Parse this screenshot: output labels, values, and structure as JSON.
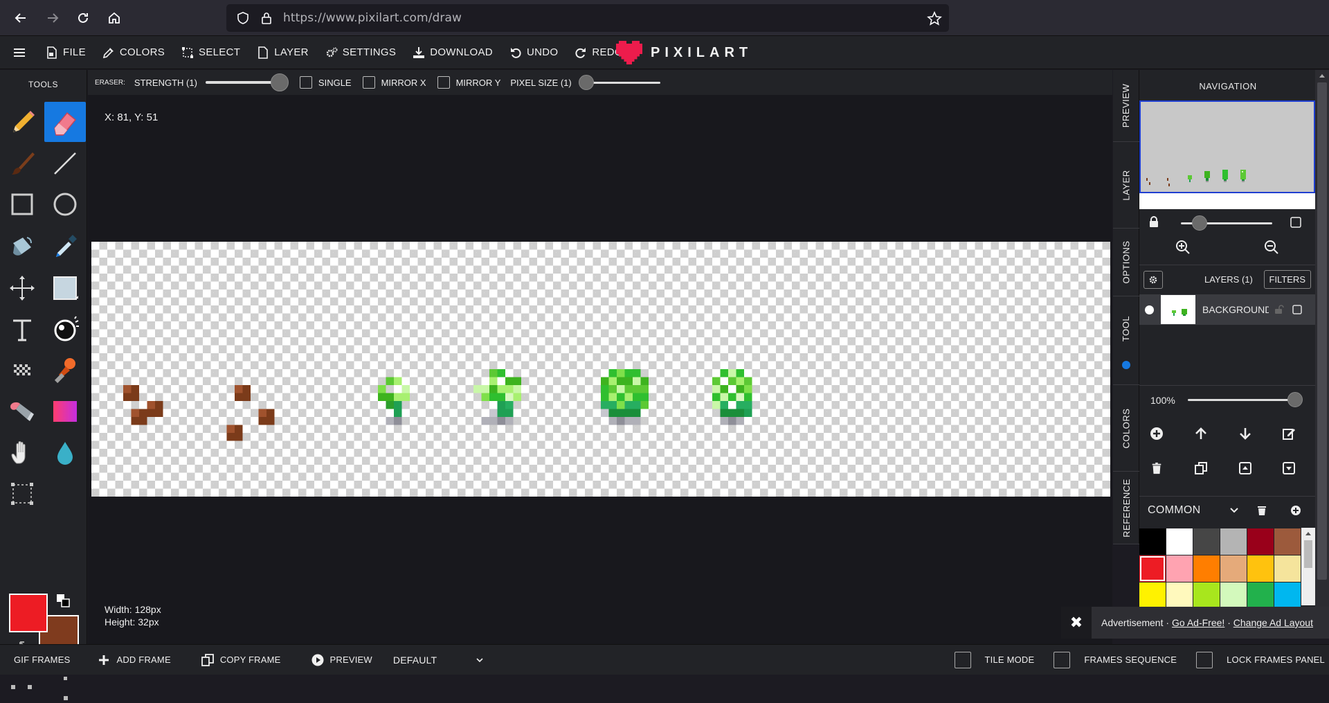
{
  "browser": {
    "url": "https://www.pixilart.com/draw"
  },
  "menu": {
    "file": "FILE",
    "colors": "COLORS",
    "select": "SELECT",
    "layer": "LAYER",
    "settings": "SETTINGS",
    "download": "DOWNLOAD",
    "undo": "UNDO",
    "redo": "REDO",
    "logo_text": "PIXILART"
  },
  "tools": {
    "title": "TOOLS",
    "active_tool": "eraser",
    "primary_color": "#ed1c24",
    "secondary_color": "#7f3b1e"
  },
  "options": {
    "tool_label": "ERASER:",
    "strength_label": "STRENGTH (1)",
    "strength_value": 1,
    "single_label": "SINGLE",
    "mirror_x_label": "MIRROR X",
    "mirror_y_label": "MIRROR Y",
    "pixel_size_label": "PIXEL SIZE (1)",
    "pixel_size_value": 1
  },
  "workspace": {
    "coords": "X: 81, Y: 51",
    "width_text": "Width: 128px",
    "height_text": "Height: 32px"
  },
  "side_tabs": {
    "preview": "PREVIEW",
    "layer": "LAYER",
    "options": "OPTIONS",
    "tool": "TOOL",
    "colors": "COLORS",
    "reference": "REFERENCE"
  },
  "panel": {
    "navigation_title": "NAVIGATION",
    "layers_title": "LAYERS (1)",
    "filters_label": "FILTERS",
    "layer_name": "BACKGROUND",
    "opacity_text": "100%",
    "opacity_value": 1.0,
    "palette_name": "COMMON",
    "swatches": [
      "#000000",
      "#ffffff",
      "#464646",
      "#b4b4b4",
      "#99001a",
      "#9c5a3c",
      "#ed1c24",
      "#ffa3b1",
      "#ff7e00",
      "#e5aa7a",
      "#ffc20e",
      "#f5e49c",
      "#fff200",
      "#fff9bd",
      "#a8e61d",
      "#d3f9bc",
      "#22b14c",
      "#00b7ef"
    ],
    "selected_swatch": 6
  },
  "ad": {
    "label": "Advertisement ·",
    "go_ad_free": "Go Ad-Free!",
    "separator": " · ",
    "change_layout": "Change Ad Layout"
  },
  "bottom": {
    "gif_frames": "GIF FRAMES",
    "add_frame": "ADD FRAME",
    "copy_frame": "COPY FRAME",
    "preview": "PREVIEW",
    "animation_preset": "DEFAULT",
    "tile_mode": "TILE MODE",
    "frames_sequence": "FRAMES SEQUENCE",
    "lock_frames_panel": "LOCK FRAMES PANEL"
  }
}
